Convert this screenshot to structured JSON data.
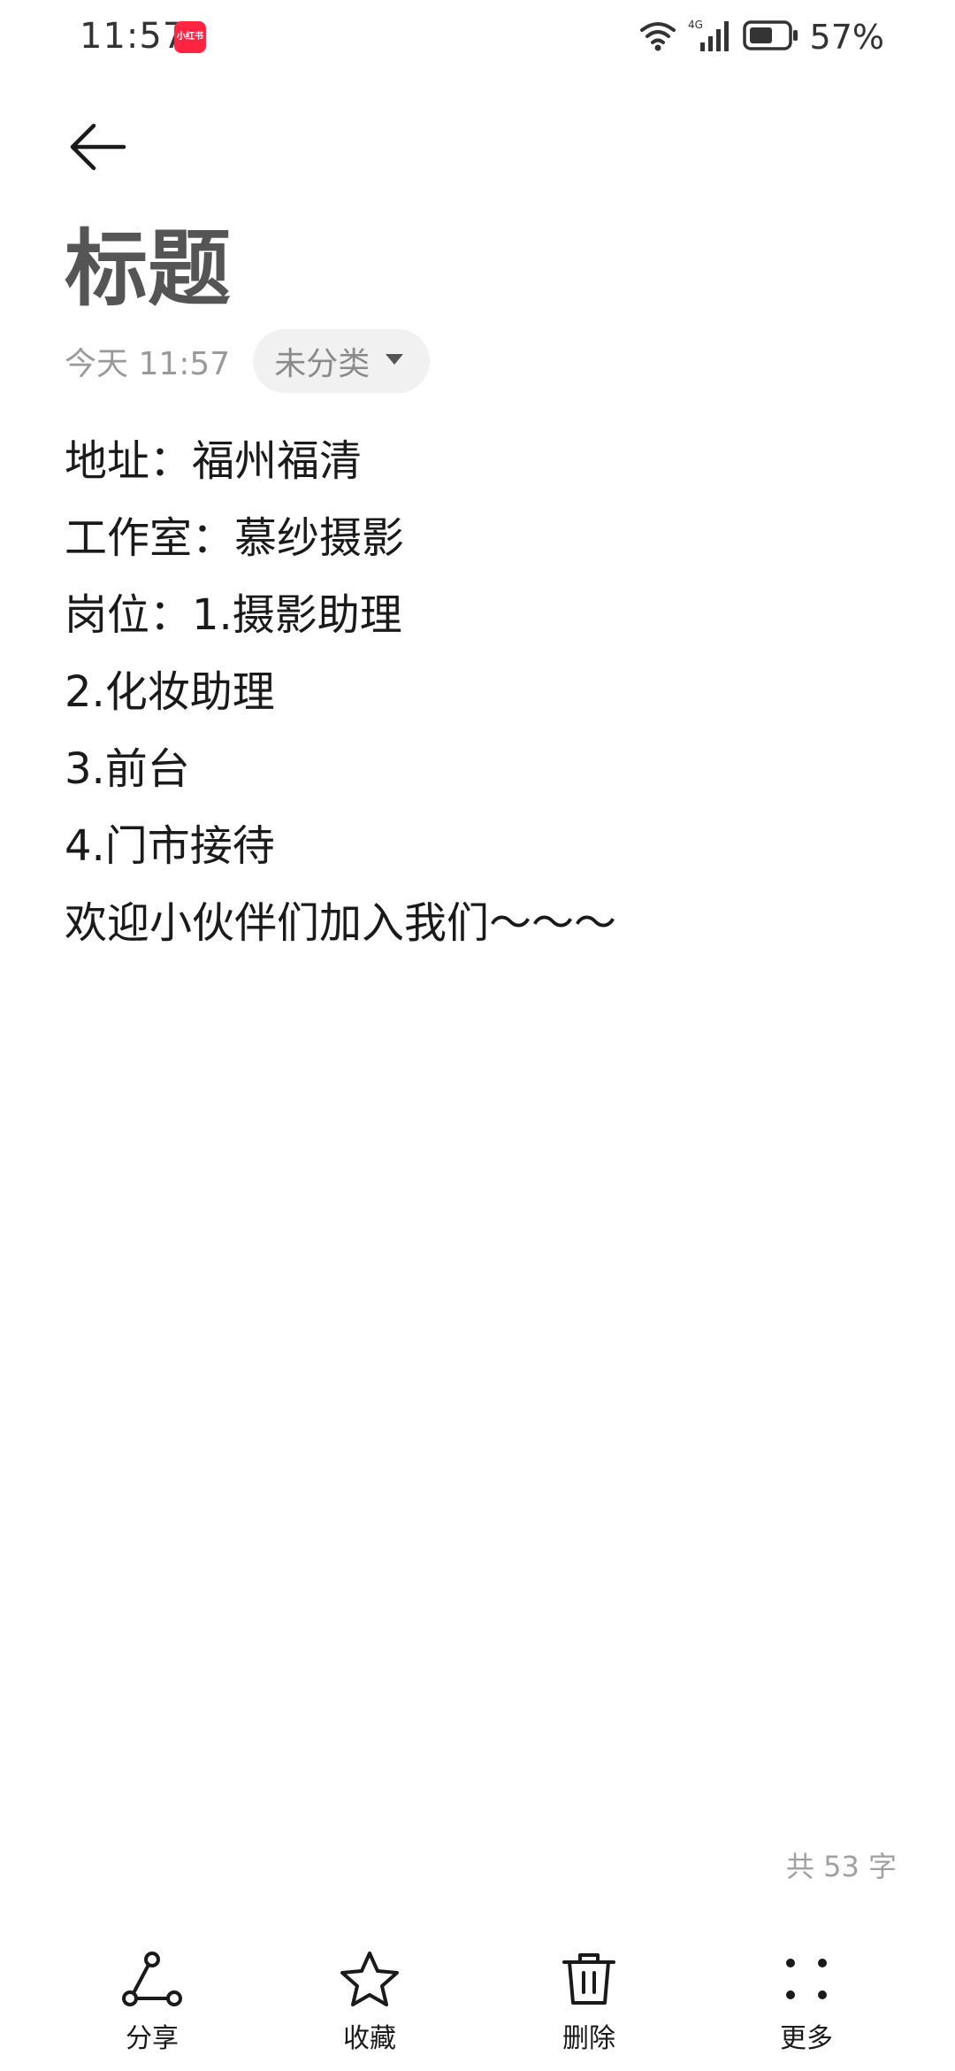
{
  "status_bar": {
    "time": "11:57",
    "app_badge": "小红书",
    "battery": "57%"
  },
  "note": {
    "title": "标题",
    "date": "今天 11:57",
    "category": "未分类",
    "lines": [
      "地址：福州福清",
      "工作室：慕纱摄影",
      "岗位：1.摄影助理",
      "2.化妆助理",
      "3.前台",
      "4.门市接待",
      "欢迎小伙伴们加入我们～～～"
    ],
    "word_count": "共 53 字"
  },
  "toolbar": {
    "share": "分享",
    "favorite": "收藏",
    "delete": "删除",
    "more": "更多"
  }
}
